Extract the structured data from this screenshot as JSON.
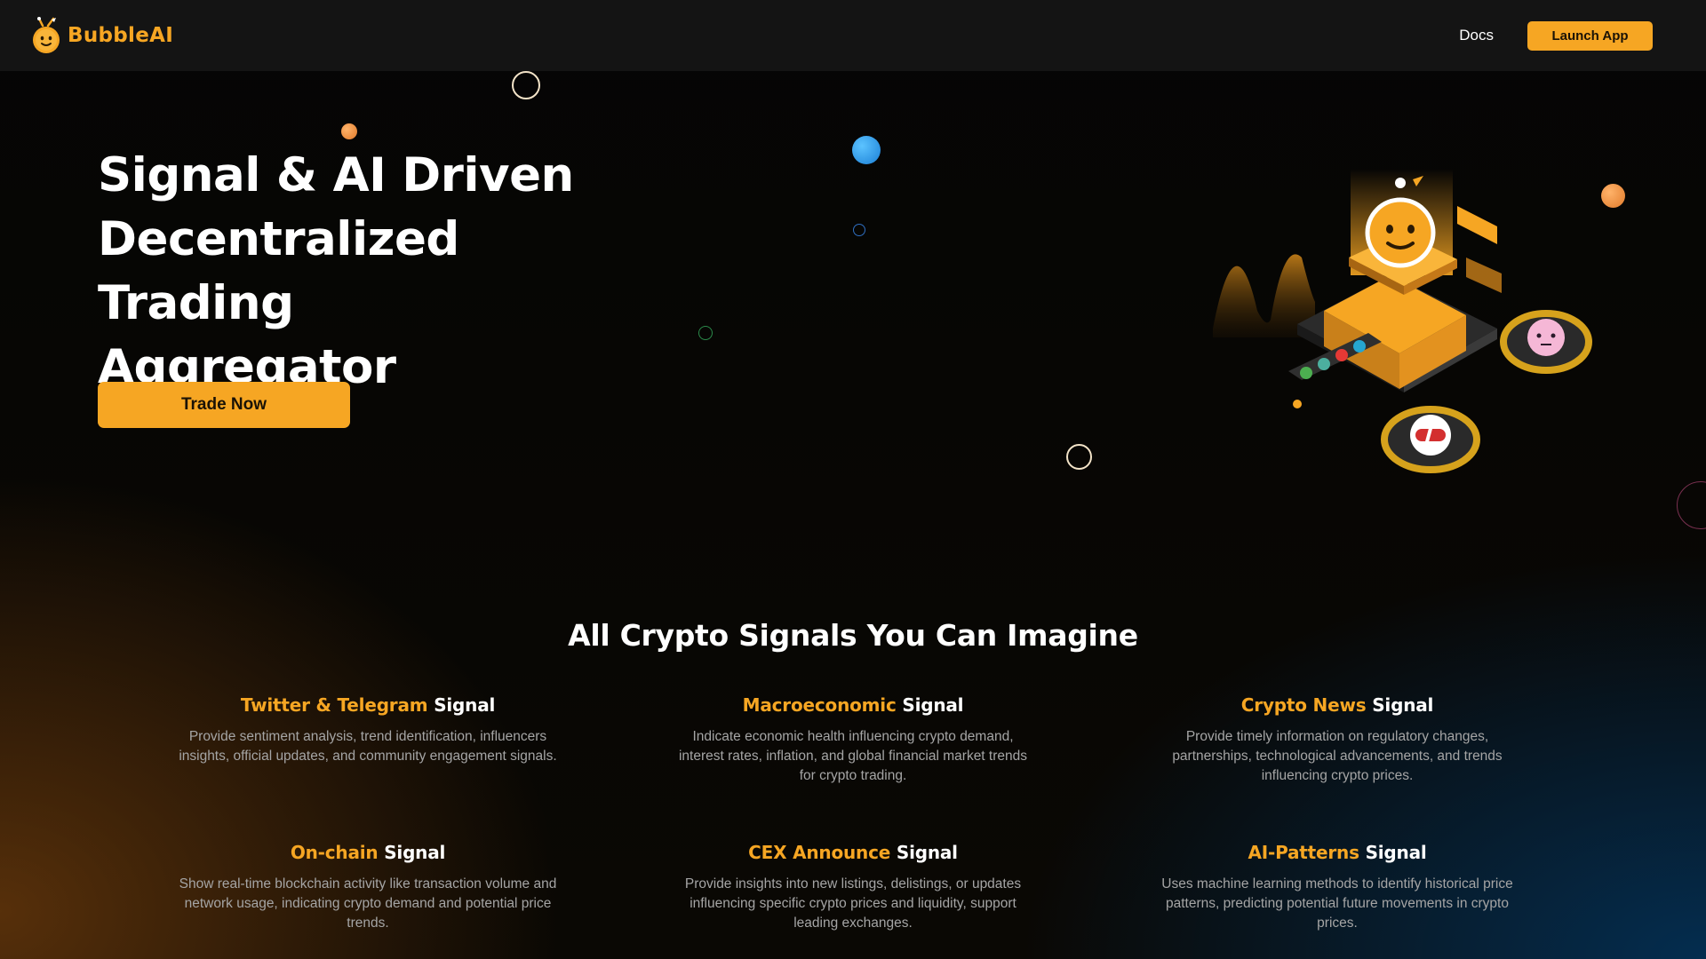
{
  "header": {
    "brand": "BubbleAI",
    "nav_docs": "Docs",
    "launch_label": "Launch App"
  },
  "hero": {
    "title_line1": "Signal & AI Driven",
    "title_line2": "Decentralized Trading",
    "title_line3": "Aggregator",
    "trade_label": "Trade Now"
  },
  "signals": {
    "title": "All Crypto Signals You Can Imagine",
    "suffix": "Signal",
    "items": [
      {
        "accent": "Twitter & Telegram",
        "desc": "Provide sentiment analysis, trend identification, influencers insights, official updates, and community engagement signals."
      },
      {
        "accent": "Macroeconomic",
        "desc": "Indicate economic health influencing crypto demand, interest rates, inflation, and global financial market trends for crypto trading."
      },
      {
        "accent": "Crypto News",
        "desc": "Provide timely information on regulatory changes, partnerships, technological advancements, and trends influencing crypto prices."
      },
      {
        "accent": "On-chain",
        "desc": "Show real-time blockchain activity like transaction volume and network usage, indicating crypto demand and potential price trends."
      },
      {
        "accent": "CEX Announce",
        "desc": "Provide insights into new listings, delistings, or updates influencing specific crypto prices and liquidity, support leading exchanges."
      },
      {
        "accent": "AI-Patterns",
        "desc": "Uses machine learning methods to identify historical price patterns, predicting potential future movements in crypto prices."
      }
    ]
  },
  "colors": {
    "accent": "#f6a623",
    "header_bg": "#141414",
    "desc_text": "#a5a5a5"
  },
  "icons": [
    "bubble-logo-icon",
    "trading-machine-illustration"
  ]
}
